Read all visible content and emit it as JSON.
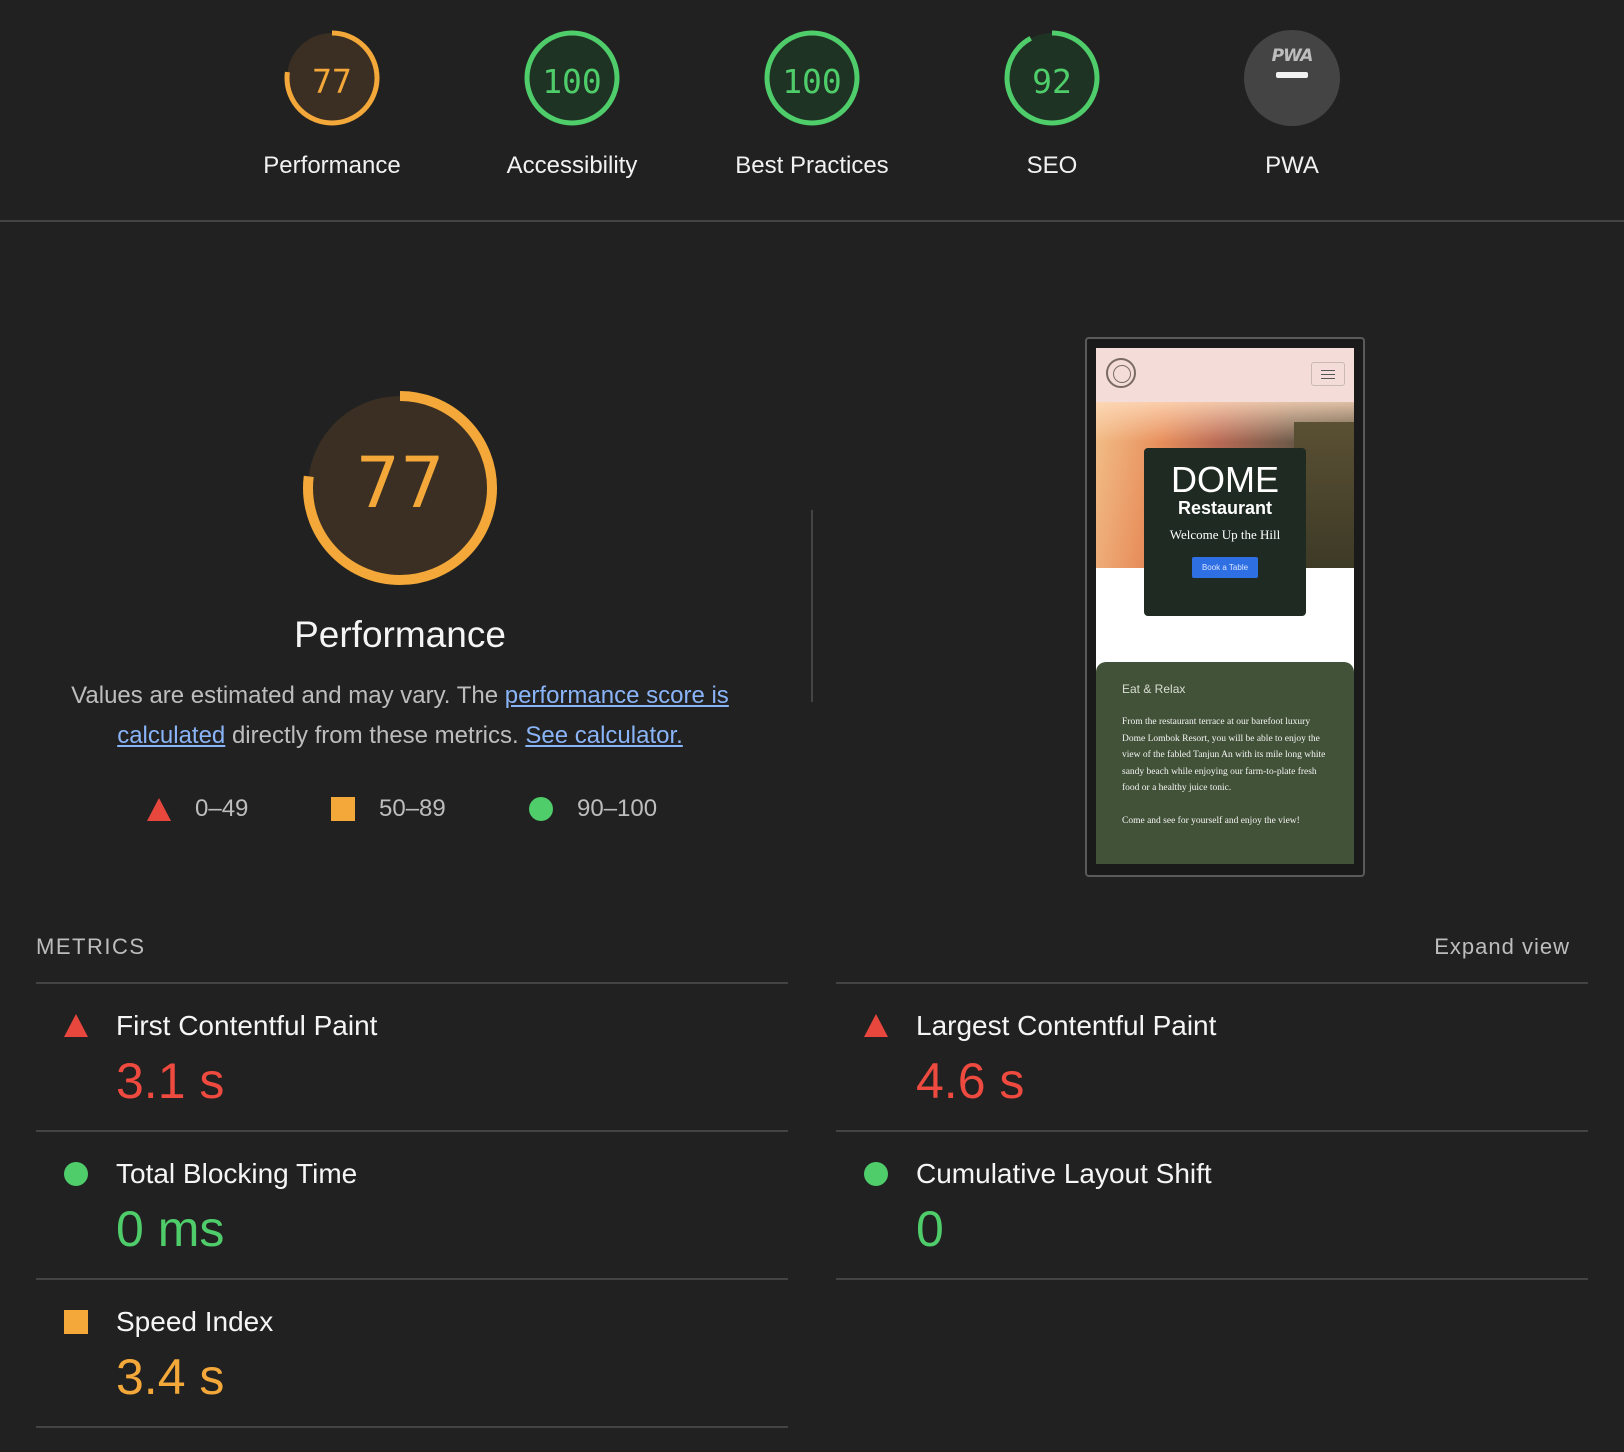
{
  "scores": [
    {
      "label": "Performance",
      "value": "77",
      "fraction": 0.77,
      "color": "#f4a83a",
      "bg": "#3a2f22"
    },
    {
      "label": "Accessibility",
      "value": "100",
      "fraction": 1.0,
      "color": "#4fcd6a",
      "bg": "#1f3324"
    },
    {
      "label": "Best Practices",
      "value": "100",
      "fraction": 1.0,
      "color": "#4fcd6a",
      "bg": "#1f3324"
    },
    {
      "label": "SEO",
      "value": "92",
      "fraction": 0.92,
      "color": "#4fcd6a",
      "bg": "#1f3324"
    },
    {
      "label": "PWA",
      "value": "PWA",
      "fraction": 0,
      "color": "#bdbdbd",
      "bg": "#444444"
    }
  ],
  "summary": {
    "score": "77",
    "score_fraction": 0.77,
    "title": "Performance",
    "desc_prefix": "Values are estimated and may vary. The ",
    "link1": "performance score is calculated",
    "desc_middle": " directly from these metrics. ",
    "link2": "See calculator."
  },
  "legend": [
    {
      "shape": "triangle",
      "range": "0–49",
      "color": "#e8473d"
    },
    {
      "shape": "square",
      "range": "50–89",
      "color": "#f4a83a"
    },
    {
      "shape": "circle",
      "range": "90–100",
      "color": "#4fcd6a"
    }
  ],
  "thumbnail": {
    "brand": "DOME",
    "subtitle": "Restaurant",
    "tagline": "Welcome Up the Hill",
    "cta": "Book a Table",
    "section_title": "Eat & Relax",
    "para1": "From the restaurant terrace at our barefoot luxury Dome Lombok Resort, you will be able to enjoy the view of the fabled Tanjun An with its mile long white sandy beach while enjoying our farm-to-plate fresh food or a healthy juice tonic.",
    "para2": "Come and see for yourself and enjoy the view!"
  },
  "metrics": {
    "section_label": "METRICS",
    "expand_label": "Expand view",
    "items": [
      {
        "name": "First Contentful Paint",
        "value": "3.1 s",
        "rating": "fail"
      },
      {
        "name": "Largest Contentful Paint",
        "value": "4.6 s",
        "rating": "fail"
      },
      {
        "name": "Total Blocking Time",
        "value": "0 ms",
        "rating": "pass"
      },
      {
        "name": "Cumulative Layout Shift",
        "value": "0",
        "rating": "pass"
      },
      {
        "name": "Speed Index",
        "value": "3.4 s",
        "rating": "average"
      }
    ]
  }
}
